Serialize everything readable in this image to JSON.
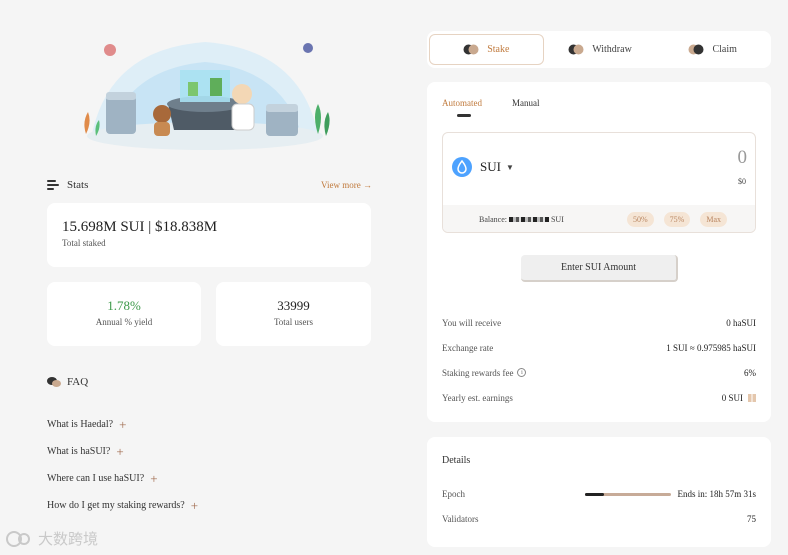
{
  "stats": {
    "title": "Stats",
    "view_more": "View more →",
    "total_staked_value": "15.698M SUI | $18.838M",
    "total_staked_label": "Total staked",
    "apy_value": "1.78%",
    "apy_label": "Annual % yield",
    "users_value": "33999",
    "users_label": "Total users"
  },
  "faq": {
    "title": "FAQ",
    "items": [
      {
        "q": "What is Haedal?"
      },
      {
        "q": "What is haSUI?"
      },
      {
        "q": "Where can I use haSUI?"
      },
      {
        "q": "How do I get my staking rewards?"
      }
    ]
  },
  "tabs": [
    {
      "label": "Stake",
      "active": true
    },
    {
      "label": "Withdraw",
      "active": false
    },
    {
      "label": "Claim",
      "active": false
    }
  ],
  "stake": {
    "modes": [
      {
        "label": "Automated",
        "active": true
      },
      {
        "label": "Manual",
        "active": false
      }
    ],
    "token": "SUI",
    "amount_placeholder": "0",
    "usd_value": "$0",
    "balance_prefix": "Balance: ",
    "balance_suffix": "SUI",
    "pct_buttons": [
      "50%",
      "75%",
      "Max"
    ],
    "enter_button": "Enter SUI Amount",
    "rows": [
      {
        "label": "You will receive",
        "value": "0 haSUI"
      },
      {
        "label": "Exchange rate",
        "value": "1 SUI ≈ 0.975985 haSUI"
      },
      {
        "label": "Staking rewards fee",
        "value": "6%"
      },
      {
        "label": "Yearly est. earnings",
        "value": "0 SUI"
      }
    ]
  },
  "details": {
    "title": "Details",
    "epoch_label": "Epoch",
    "epoch_progress": 0.22,
    "epoch_ends": "Ends in: 18h 57m 31s",
    "validators_label": "Validators",
    "validators_value": "75"
  },
  "watermark": "大数跨境",
  "colors": {
    "accent": "#c07a3d",
    "apy_green": "#3e9a4b",
    "sui_blue": "#4da2ff"
  }
}
